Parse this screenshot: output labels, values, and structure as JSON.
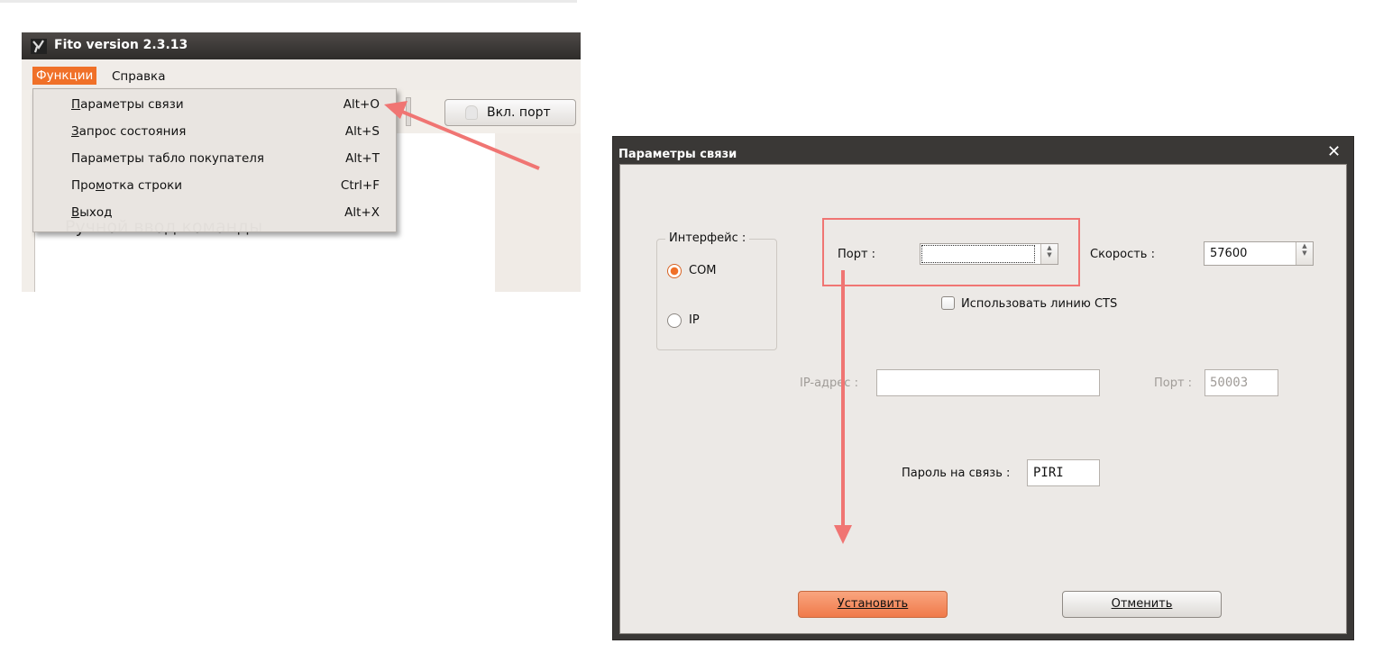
{
  "left_window": {
    "title": "Fito version 2.3.13",
    "menu": {
      "functions": "Функции",
      "help": "Справка"
    },
    "connect_button": "Вкл. порт",
    "background_text": "Ручной ввод команды",
    "dropdown": [
      {
        "pre": "",
        "ul": "П",
        "post": "араметры связи",
        "shortcut": "Alt+O"
      },
      {
        "pre": "",
        "ul": "З",
        "post": "апрос состояния",
        "shortcut": "Alt+S"
      },
      {
        "pre": "Параметры табло покупателя",
        "ul": "",
        "post": "",
        "shortcut": "Alt+T"
      },
      {
        "pre": "Про",
        "ul": "м",
        "post": "отка строки",
        "shortcut": "Ctrl+F"
      },
      {
        "pre": "",
        "ul": "В",
        "post": "ыход",
        "shortcut": "Alt+X"
      }
    ]
  },
  "dialog": {
    "title": "Параметры связи",
    "close": "✕",
    "interface_group": "Интерфейс :",
    "com_label": "COM",
    "ip_label": "IP",
    "port_label": "Порт :",
    "port_value": "",
    "speed_label": "Скорость :",
    "speed_value": "57600",
    "cts_label": "Использовать линию CTS",
    "ip_address_label": "IP-адрес :",
    "ip_address_value": "",
    "ip_port_label": "Порт :",
    "ip_port_value": "50003",
    "password_label": "Пароль на связь :",
    "password_value": "PIRI",
    "ok_button": "Установить",
    "cancel_button": "Отменить"
  },
  "colors": {
    "accent": "#f07028",
    "annotation": "#f07573",
    "dialog_frame": "#3a3836",
    "dialog_bg": "#ece9e6"
  }
}
